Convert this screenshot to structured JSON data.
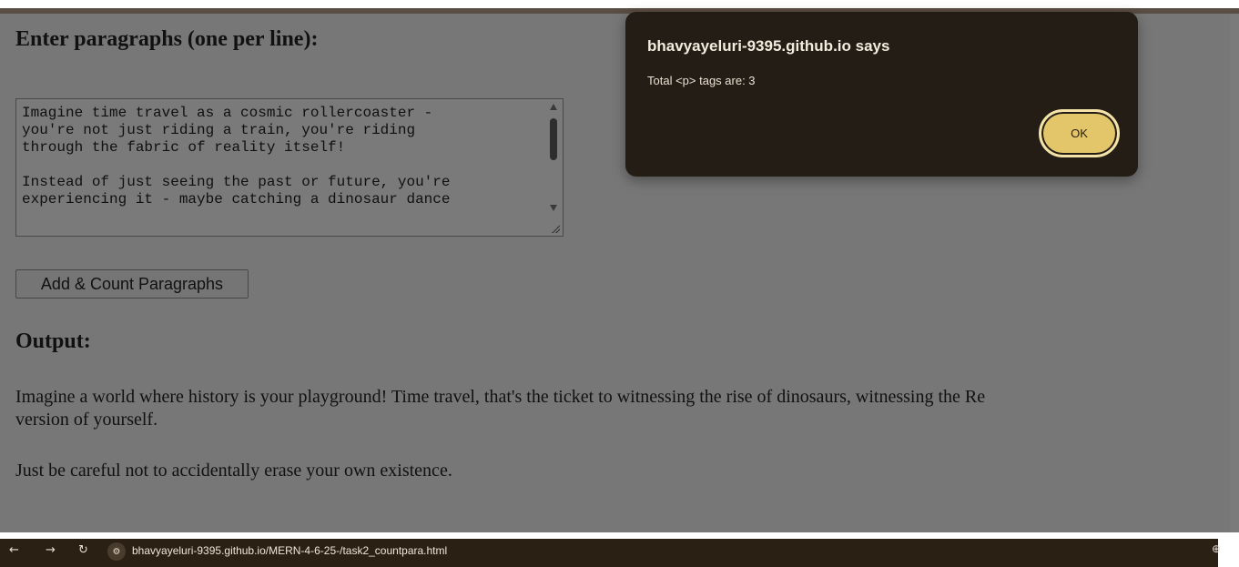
{
  "page": {
    "heading": "Enter paragraphs (one per line):",
    "textarea": {
      "value": "Imagine time travel as a cosmic rollercoaster -\nyou're not just riding a train, you're riding\nthrough the fabric of reality itself!\n\nInstead of just seeing the past or future, you're\nexperiencing it - maybe catching a dinosaur dance"
    },
    "button_label": "Add & Count Paragraphs",
    "output_heading": "Output:",
    "output_paragraphs": [
      "Imagine a world where history is your playground! Time travel, that's the ticket to witnessing the rise of dinosaurs, witnessing the Re",
      "version of yourself.",
      "Just be careful not to accidentally erase your own existence."
    ]
  },
  "dialog": {
    "title": "bhavyayeluri-9395.github.io says",
    "message": "Total <p> tags are: 3",
    "ok_label": "OK"
  },
  "browser": {
    "url": "bhavyayeluri-9395.github.io/MERN-4-6-25-/task2_countpara.html",
    "icons": [
      "back-icon",
      "forward-icon",
      "reload-icon",
      "site-settings-icon"
    ]
  },
  "colors": {
    "dialog_bg": "#231d15",
    "ok_button": "#e3c56a",
    "overlay_page": "#777777",
    "browser_bar": "#2b2014"
  }
}
